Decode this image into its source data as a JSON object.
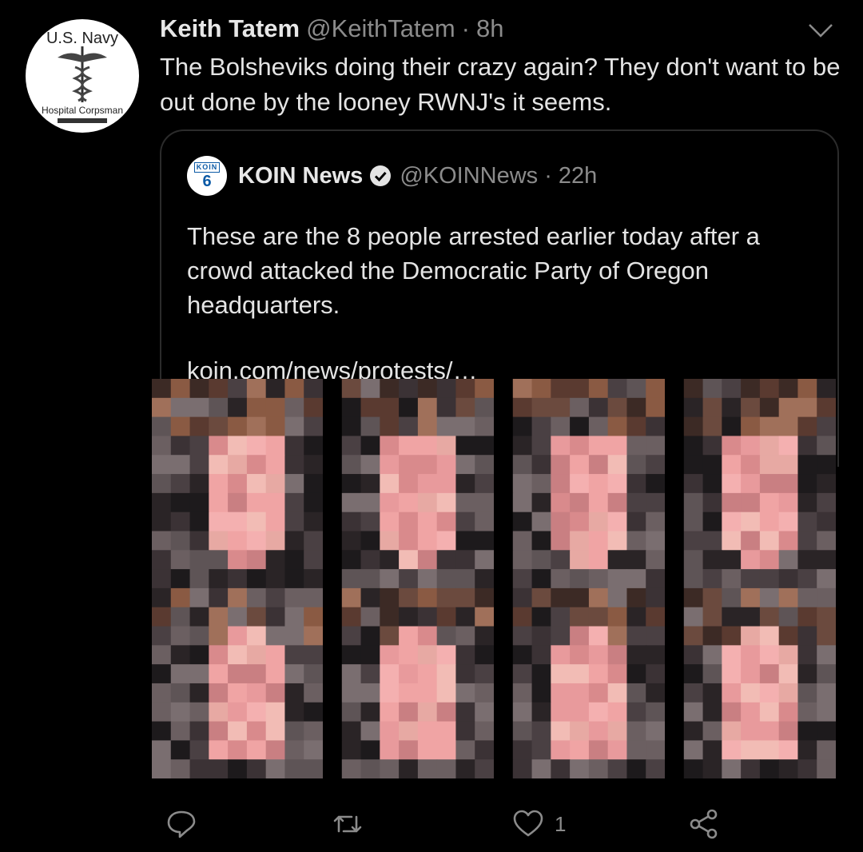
{
  "author": {
    "name": "Keith Tatem",
    "handle": "@KeithTatem",
    "time": "8h",
    "avatar_top_text": "U.S. Navy",
    "avatar_bottom_text": "Hospital Corpsman"
  },
  "tweet": {
    "text": "The Bolsheviks doing their crazy again? They don't want to be out done by the looney RWNJ's it seems."
  },
  "quoted": {
    "logo_top": "KOIN",
    "logo_main": "6",
    "name": "KOIN News",
    "handle": "@KOINNews",
    "time": "22h",
    "text": "These are the 8 people arrested earlier today after a crowd attacked the Democratic Party of Oregon headquarters.",
    "link": "koin.com/news/protests/…"
  },
  "actions": {
    "reply_count": "",
    "retweet_count": "",
    "like_count": "1",
    "share_count": ""
  },
  "colors": {
    "background": "#000000",
    "primary_text": "#e4e4e4",
    "secondary_text": "#8b8b8b",
    "border": "#2b2b2b",
    "icon": "#8b8b8b"
  },
  "icons": {
    "reply": "reply-icon",
    "retweet": "retweet-icon",
    "like": "heart-icon",
    "share": "share-icon",
    "menu": "chevron-down-icon",
    "verified": "verified-badge-icon"
  }
}
